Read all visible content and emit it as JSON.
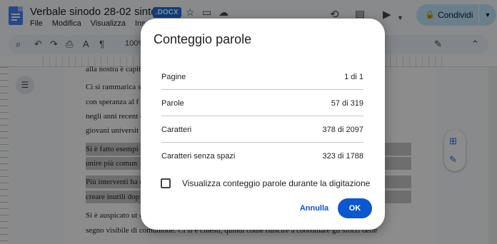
{
  "app": {
    "title": "Verbale sinodo 28-02 sintesi",
    "badge": ".DOCX",
    "menu": [
      "File",
      "Modifica",
      "Visualizza",
      "Inser"
    ],
    "share_label": "Condividi"
  },
  "toolbar": {
    "zoom": "100%"
  },
  "document": {
    "lines": [
      "alla nostra è capita",
      "Ci si rammarica                                                                                                      si guarda",
      "con speranza al f                                                                                                      mente",
      "negli anni recent                                                                                                      casa dei",
      "giovani universit",
      "Si è fatto esempi                                                                                                      mente e",
      "unire più comun",
      "Più interventi ha                                                                                                      di non",
      "creare inutili dop",
      "Si è auspicato ut                                                                                                      che",
      "segno visibile di comunione. Ci si è chiesti, quindi come riuscire a coordinare gli sforzi delle"
    ]
  },
  "dialog": {
    "title": "Conteggio parole",
    "stats": [
      {
        "label": "Pagine",
        "value": "1 di 1"
      },
      {
        "label": "Parole",
        "value": "57 di 319"
      },
      {
        "label": "Caratteri",
        "value": "378 di 2097"
      },
      {
        "label": "Caratteri senza spazi",
        "value": "323 di 1788"
      }
    ],
    "checkbox_label": "Visualizza conteggio parole durante la digitazione",
    "checkbox_checked": false,
    "cancel_label": "Annulla",
    "ok_label": "OK"
  },
  "colors": {
    "accent": "#0b57d0",
    "share_bg": "#c2e7ff",
    "docs_blue": "#4285f4"
  }
}
